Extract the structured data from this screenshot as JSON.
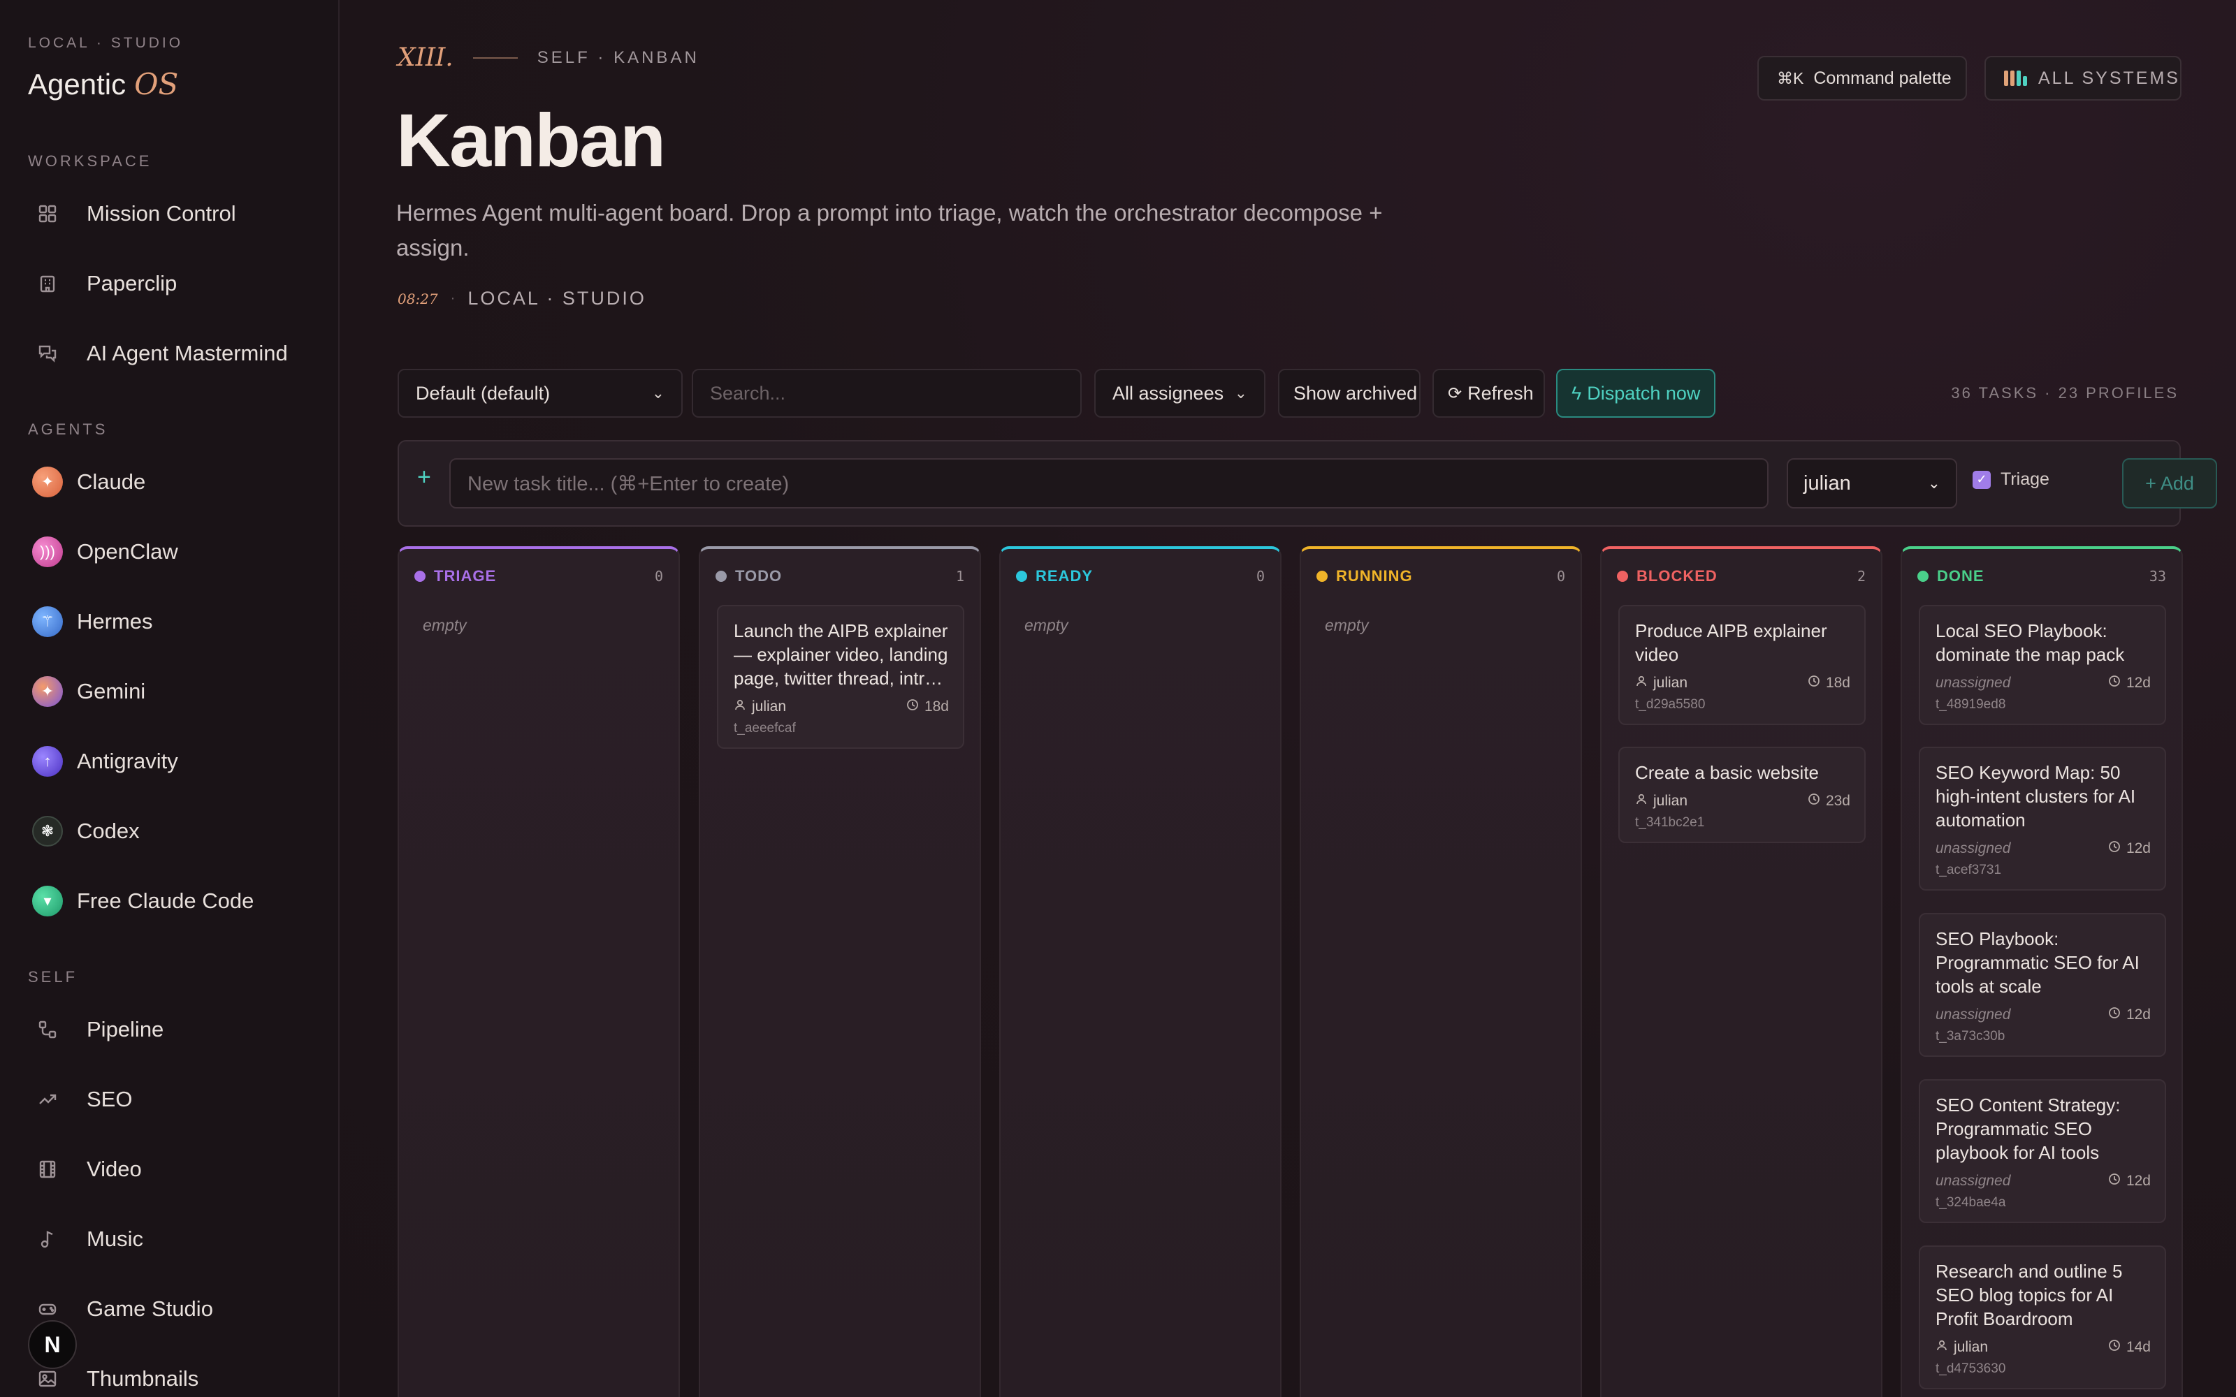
{
  "sidebar": {
    "eyebrow": "LOCAL · STUDIO",
    "brand_name": "Agentic",
    "brand_suffix": "OS",
    "sections": {
      "workspace": "WORKSPACE",
      "agents": "AGENTS",
      "self": "SELF"
    },
    "workspace_items": [
      {
        "label": "Mission Control",
        "icon": "grid-icon"
      },
      {
        "label": "Paperclip",
        "icon": "building-icon"
      },
      {
        "label": "AI Agent Mastermind",
        "icon": "chat-icon"
      }
    ],
    "agent_items": [
      {
        "label": "Claude",
        "icon": "claude-icon",
        "color": "#e9805a"
      },
      {
        "label": "OpenClaw",
        "icon": "openclaw-icon",
        "color": "#e05aa8"
      },
      {
        "label": "Hermes",
        "icon": "hermes-icon",
        "color": "#4d8fe0"
      },
      {
        "label": "Gemini",
        "icon": "gemini-icon",
        "color": "#8a6ae6"
      },
      {
        "label": "Antigravity",
        "icon": "antigravity-icon",
        "color": "#6c4fe0"
      },
      {
        "label": "Codex",
        "icon": "codex-icon",
        "color": "#2b2b2b"
      },
      {
        "label": "Free Claude Code",
        "icon": "free-claude-code-icon",
        "color": "#2fbf8a"
      }
    ],
    "self_items": [
      {
        "label": "Pipeline",
        "icon": "pipeline-icon"
      },
      {
        "label": "SEO",
        "icon": "trend-icon"
      },
      {
        "label": "Video",
        "icon": "film-icon"
      },
      {
        "label": "Music",
        "icon": "music-note-icon"
      },
      {
        "label": "Game Studio",
        "icon": "gamepad-icon"
      },
      {
        "label": "Thumbnails",
        "icon": "image-icon"
      }
    ],
    "badge": "N"
  },
  "header": {
    "roman": "XIII.",
    "eyebrow": "SELF · KANBAN",
    "title": "Kanban",
    "subtitle": "Hermes Agent multi-agent board. Drop a prompt into triage, watch the orchestrator decompose + assign.",
    "time": "08:27",
    "separator": "·",
    "location": "LOCAL · STUDIO",
    "command_palette_kbd": "⌘K",
    "command_palette_label": "Command palette",
    "systems_label": "ALL SYSTEMS"
  },
  "toolbar": {
    "board_select": "Default (default)",
    "search_placeholder": "Search...",
    "assignee_select": "All assignees",
    "show_archived": "Show archived",
    "refresh": "Refresh",
    "dispatch": "Dispatch now",
    "counts": "36 TASKS · 23 PROFILES"
  },
  "new_task": {
    "plus": "+",
    "placeholder": "New task title... (⌘+Enter to create)",
    "assignee": "julian",
    "triage_label": "Triage",
    "triage_checked": true,
    "add_label": "+ Add"
  },
  "columns": [
    {
      "name": "TRIAGE",
      "count": "0",
      "color": "#a970e8",
      "empty": "empty",
      "cards": []
    },
    {
      "name": "TODO",
      "count": "1",
      "color": "#9a9aa8",
      "empty": "",
      "cards": [
        {
          "title": "Launch the AIPB explainer — explainer video, landing page, twitter thread, intro to the series",
          "assignee": "julian",
          "unassigned": false,
          "age": "18d",
          "id": "t_aeeefcaf"
        }
      ]
    },
    {
      "name": "READY",
      "count": "0",
      "color": "#2cc7dc",
      "empty": "empty",
      "cards": []
    },
    {
      "name": "RUNNING",
      "count": "0",
      "color": "#f0b429",
      "empty": "empty",
      "cards": []
    },
    {
      "name": "BLOCKED",
      "count": "2",
      "color": "#f06262",
      "empty": "",
      "cards": [
        {
          "title": "Produce AIPB explainer video",
          "assignee": "julian",
          "unassigned": false,
          "age": "18d",
          "id": "t_d29a5580"
        },
        {
          "title": "Create a basic website",
          "assignee": "julian",
          "unassigned": false,
          "age": "23d",
          "id": "t_341bc2e1"
        }
      ]
    },
    {
      "name": "DONE",
      "count": "33",
      "color": "#4ad08a",
      "empty": "",
      "cards": [
        {
          "title": "Local SEO Playbook: dominate the map pack",
          "assignee": "unassigned",
          "unassigned": true,
          "age": "12d",
          "id": "t_48919ed8"
        },
        {
          "title": "SEO Keyword Map: 50 high-intent clusters for AI automation",
          "assignee": "unassigned",
          "unassigned": true,
          "age": "12d",
          "id": "t_acef3731"
        },
        {
          "title": "SEO Playbook: Programmatic SEO for AI tools at scale",
          "assignee": "unassigned",
          "unassigned": true,
          "age": "12d",
          "id": "t_3a73c30b"
        },
        {
          "title": "SEO Content Strategy: Programmatic SEO playbook for AI tools",
          "assignee": "unassigned",
          "unassigned": true,
          "age": "12d",
          "id": "t_324bae4a"
        },
        {
          "title": "Research and outline 5 SEO blog topics for AI Profit Boardroom",
          "assignee": "julian",
          "unassigned": false,
          "age": "14d",
          "id": "t_d4753630"
        }
      ]
    }
  ]
}
